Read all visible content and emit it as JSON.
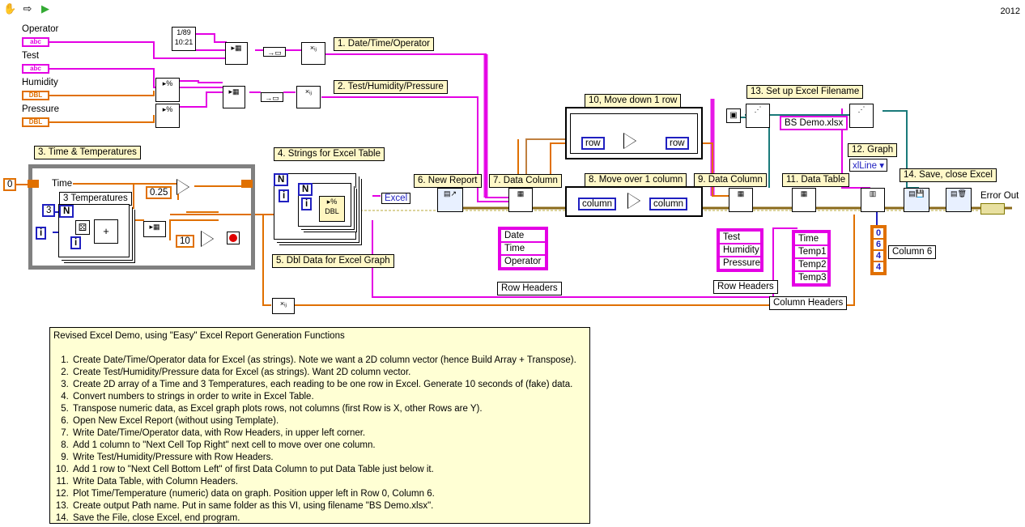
{
  "toolbar": {
    "tools": [
      "hand-icon",
      "arrow-icon",
      "run-icon"
    ]
  },
  "year": "2012",
  "controls": {
    "operator": {
      "label": "Operator",
      "type": "abc"
    },
    "test": {
      "label": "Test",
      "type": "abc"
    },
    "humidity": {
      "label": "Humidity",
      "type": "DBL"
    },
    "pressure": {
      "label": "Pressure",
      "type": "DBL"
    }
  },
  "labels": {
    "l1": "1.  Date/Time/Operator",
    "l2": "2.  Test/Humidity/Pressure",
    "l3": "3.  Time & Temperatures",
    "l4": "4. Strings for Excel Table",
    "l5": "5.  Dbl Data for Excel Graph",
    "l6": "6.  New Report",
    "l7": "7.  Data Column",
    "l8": "8.  Move over 1 column",
    "l9": "9.  Data Column",
    "l10": "10,  Move down 1 row",
    "l11": "11. Data Table",
    "l12": "12. Graph",
    "l13": "13. Set up Excel Filename",
    "l14": "14. Save, close Excel"
  },
  "loop": {
    "time_label": "Time",
    "temps_label": "3 Temperatures",
    "const_init": "0",
    "const_n": "3",
    "const_step": "0.25",
    "const_limit": "10",
    "iter": "i",
    "count": "N"
  },
  "constants": {
    "excel_ring": "Excel",
    "xlline": "xlLine",
    "filename": "BS Demo.xlsx",
    "row": "row",
    "column": "column",
    "error_out": "Error Out"
  },
  "row_headers_1": {
    "items": [
      "Date",
      "Time",
      "Operator"
    ],
    "caption": "Row Headers"
  },
  "row_headers_2": {
    "items": [
      "Test",
      "Humidity",
      "Pressure"
    ],
    "caption": "Row Headers"
  },
  "col_headers": {
    "items": [
      "Time",
      "Temp1",
      "Temp2",
      "Temp3"
    ],
    "caption": "Column Headers"
  },
  "position_array": {
    "items": [
      "0",
      "6",
      "4",
      "4"
    ],
    "caption": "Column 6"
  },
  "comment": {
    "intro": "Revised Excel Demo, using \"Easy\" Excel Report Generation Functions",
    "steps": [
      "Create Date/Time/Operator data for Excel (as strings).  Note we want a 2D column vector (hence Build Array + Transpose).",
      "Create Test/Humidity/Pressure data for Excel (as strings).  Want 2D column vector.",
      "Create 2D array of a Time and 3 Temperatures, each reading to be one row in Excel.  Generate 10 seconds of (fake) data.",
      "Convert numbers to strings in order to write in Excel Table.",
      "Transpose numeric data, as Excel graph plots rows, not columns (first Row is X, other Rows are Y).",
      "Open New Excel Report (without using Template).",
      "Write Date/Time/Operator data, with Row Headers, in upper left corner.",
      "Add 1 column to \"Next Cell Top Right\" next cell to move over one column.",
      "Write Test/Humidity/Pressure with Row Headers.",
      "Add 1 row to \"Next Cell Bottom Left\" of first Data Column to put Data Table just below it.",
      "Write Data Table, with Column Headers.",
      "Plot Time/Temperature (numeric) data on graph.  Position upper left in Row 0, Column 6.",
      "Create output Path name.  Put in same folder as this VI, using filename \"BS Demo.xlsx\".",
      "Save the File, close Excel, end program."
    ]
  }
}
